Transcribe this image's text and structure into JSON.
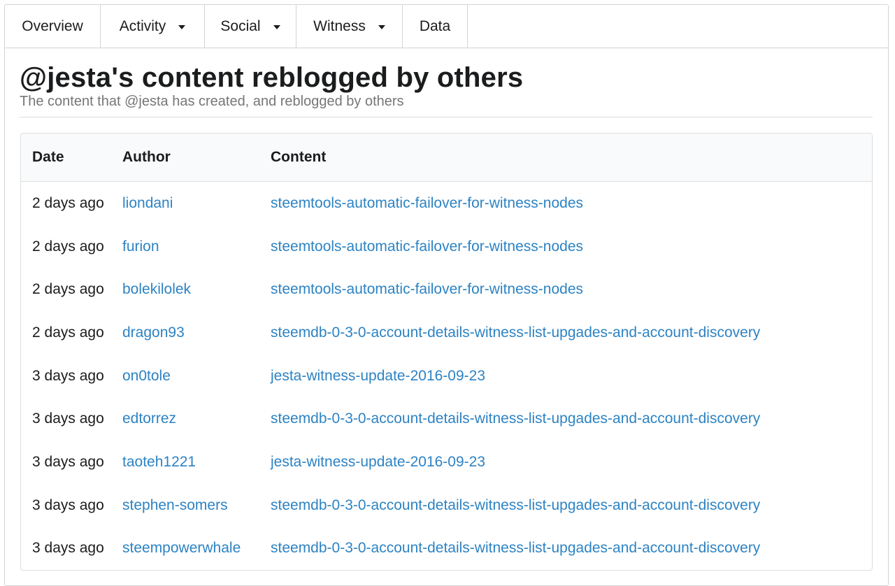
{
  "nav": {
    "items": [
      {
        "label": "Overview",
        "has_dropdown": false
      },
      {
        "label": "Activity",
        "has_dropdown": true
      },
      {
        "label": "Social",
        "has_dropdown": true
      },
      {
        "label": "Witness",
        "has_dropdown": true
      },
      {
        "label": "Data",
        "has_dropdown": false
      }
    ]
  },
  "page": {
    "title": "@jesta's content reblogged by others",
    "subtitle": "The content that @jesta has created, and reblogged by others"
  },
  "table": {
    "headers": {
      "date": "Date",
      "author": "Author",
      "content": "Content"
    },
    "rows": [
      {
        "date": "2 days ago",
        "author": "liondani",
        "content": "steemtools-automatic-failover-for-witness-nodes"
      },
      {
        "date": "2 days ago",
        "author": "furion",
        "content": "steemtools-automatic-failover-for-witness-nodes"
      },
      {
        "date": "2 days ago",
        "author": "bolekilolek",
        "content": "steemtools-automatic-failover-for-witness-nodes"
      },
      {
        "date": "2 days ago",
        "author": "dragon93",
        "content": "steemdb-0-3-0-account-details-witness-list-upgades-and-account-discovery"
      },
      {
        "date": "3 days ago",
        "author": "on0tole",
        "content": "jesta-witness-update-2016-09-23"
      },
      {
        "date": "3 days ago",
        "author": "edtorrez",
        "content": "steemdb-0-3-0-account-details-witness-list-upgades-and-account-discovery"
      },
      {
        "date": "3 days ago",
        "author": "taoteh1221",
        "content": "jesta-witness-update-2016-09-23"
      },
      {
        "date": "3 days ago",
        "author": "stephen-somers",
        "content": "steemdb-0-3-0-account-details-witness-list-upgades-and-account-discovery"
      },
      {
        "date": "3 days ago",
        "author": "steempowerwhale",
        "content": "steemdb-0-3-0-account-details-witness-list-upgades-and-account-discovery"
      }
    ]
  },
  "colors": {
    "link": "#2d83c3",
    "text": "#1b1c1d",
    "muted": "#767676",
    "header_bg": "#f9fafb",
    "border": "#d4d4d5"
  }
}
